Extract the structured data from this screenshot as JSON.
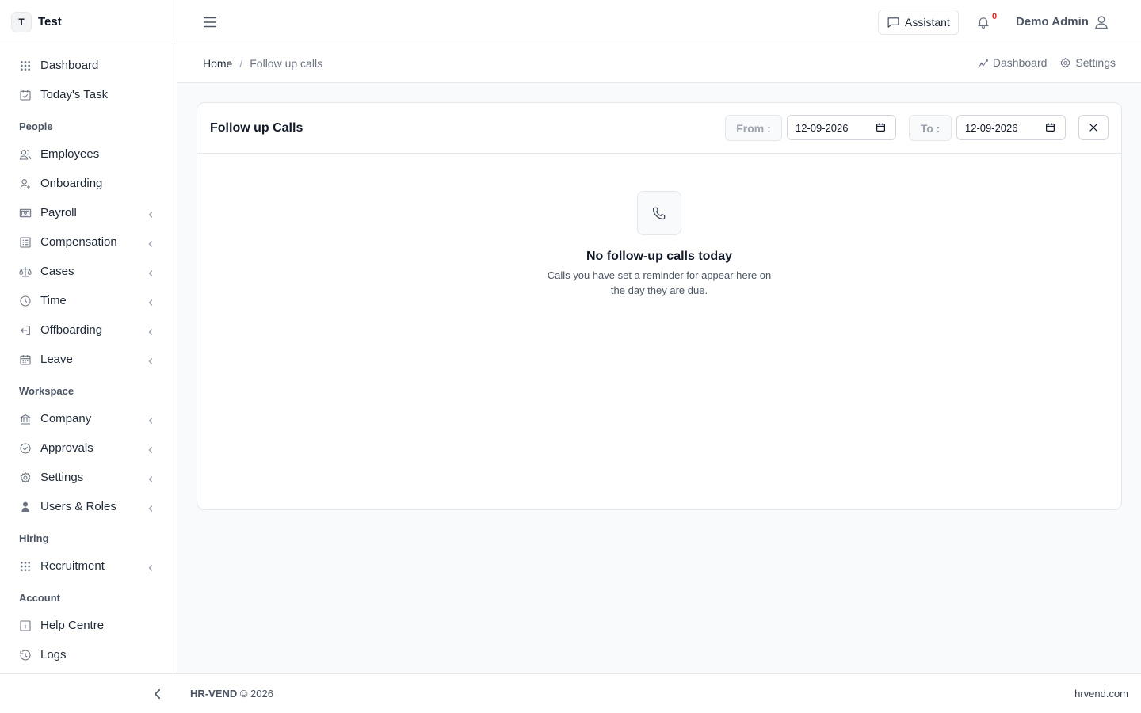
{
  "brand": {
    "badge": "T",
    "name": "Test"
  },
  "sidebar": {
    "top_items": [
      {
        "label": "Dashboard",
        "icon": "grid-icon"
      },
      {
        "label": "Today's Task",
        "icon": "calendar-check-icon"
      }
    ],
    "sections": [
      {
        "label": "People",
        "items": [
          {
            "label": "Employees",
            "icon": "users-icon",
            "expandable": false
          },
          {
            "label": "Onboarding",
            "icon": "user-plus-icon",
            "expandable": false
          },
          {
            "label": "Payroll",
            "icon": "money-icon",
            "expandable": true
          },
          {
            "label": "Compensation",
            "icon": "list-icon",
            "expandable": true
          },
          {
            "label": "Cases",
            "icon": "scale-icon",
            "expandable": true
          },
          {
            "label": "Time",
            "icon": "clock-icon",
            "expandable": true
          },
          {
            "label": "Offboarding",
            "icon": "logout-icon",
            "expandable": true
          },
          {
            "label": "Leave",
            "icon": "calendar-icon",
            "expandable": true
          }
        ]
      },
      {
        "label": "Workspace",
        "items": [
          {
            "label": "Company",
            "icon": "bank-icon",
            "expandable": true
          },
          {
            "label": "Approvals",
            "icon": "check-circle-icon",
            "expandable": true
          },
          {
            "label": "Settings",
            "icon": "gear-icon",
            "expandable": true
          },
          {
            "label": "Users & Roles",
            "icon": "user-shield-icon",
            "expandable": true
          }
        ]
      },
      {
        "label": "Hiring",
        "items": [
          {
            "label": "Recruitment",
            "icon": "grid-icon",
            "expandable": true
          }
        ]
      },
      {
        "label": "Account",
        "items": [
          {
            "label": "Help Centre",
            "icon": "info-icon",
            "expandable": false
          },
          {
            "label": "Logs",
            "icon": "history-icon",
            "expandable": false
          }
        ]
      }
    ]
  },
  "topbar": {
    "assistant_label": "Assistant",
    "notification_count": "0",
    "user_name": "Demo Admin"
  },
  "breadcrumb": {
    "home": "Home",
    "separator": "/",
    "current": "Follow up calls",
    "actions": {
      "dashboard": "Dashboard",
      "settings": "Settings"
    }
  },
  "card": {
    "title": "Follow up Calls",
    "from_label": "From :",
    "from_value": "12-09-2026",
    "to_label": "To :",
    "to_value": "12-09-2026"
  },
  "empty_state": {
    "title": "No follow-up calls today",
    "description": "Calls you have set a reminder for appear here on the day they are due."
  },
  "footer": {
    "brand": "HR-VEND",
    "copyright": "© 2026",
    "site": "hrvend.com"
  },
  "colors": {
    "accent_text": "#111827",
    "badge_red": "#dc2626",
    "border": "#e5e7eb",
    "background": "#f9fafb"
  }
}
